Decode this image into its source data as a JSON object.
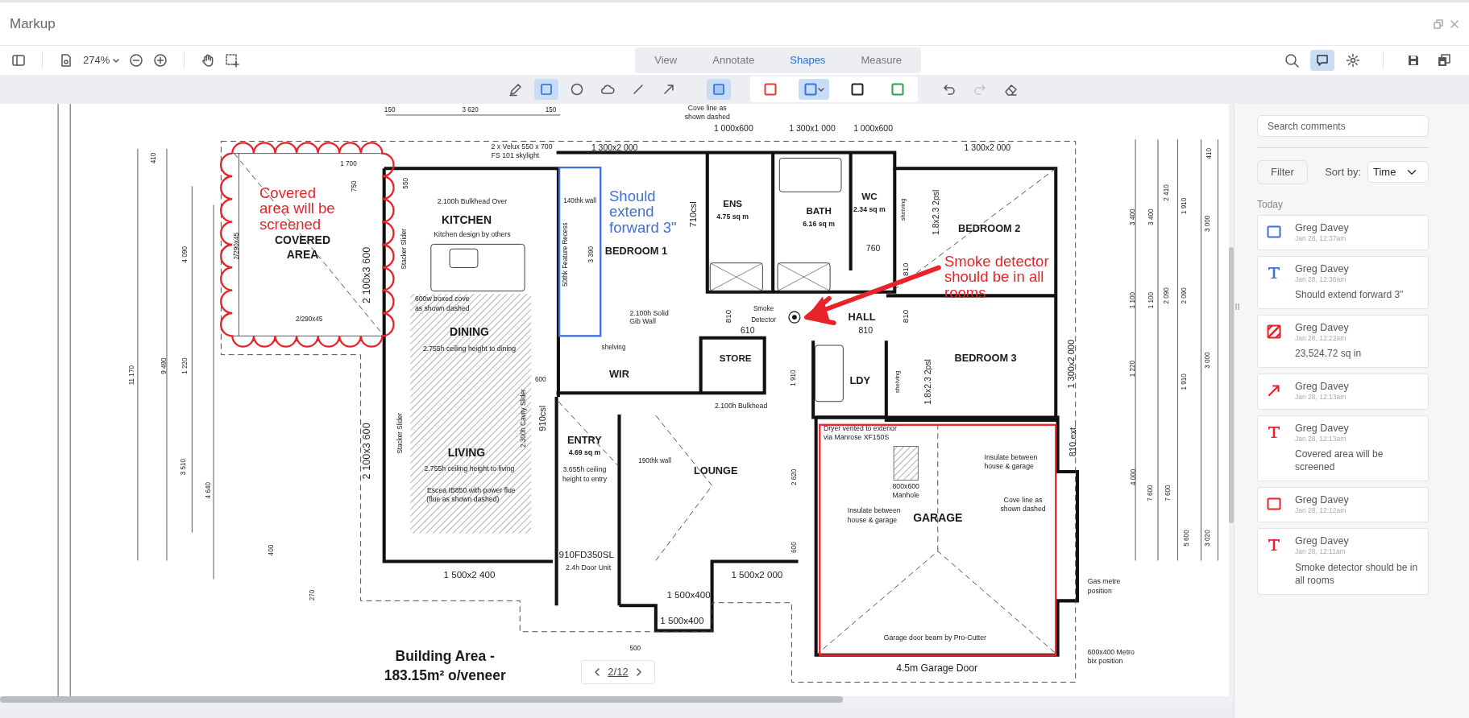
{
  "window": {
    "title": "Markup"
  },
  "toolbar": {
    "zoom": "274%",
    "comments_open": true,
    "tabs": [
      {
        "label": "View",
        "selected": false
      },
      {
        "label": "Annotate",
        "selected": false
      },
      {
        "label": "Shapes",
        "selected": true
      },
      {
        "label": "Measure",
        "selected": false
      }
    ]
  },
  "shape_tools": [
    {
      "kind": "pen",
      "selected": false
    },
    {
      "kind": "rectangle",
      "selected": true
    },
    {
      "kind": "ellipse",
      "selected": false
    },
    {
      "kind": "cloud",
      "selected": false
    },
    {
      "kind": "line",
      "selected": false
    },
    {
      "kind": "arrow",
      "selected": false
    },
    {
      "kind": "fill",
      "selected": true
    }
  ],
  "swatches": [
    {
      "color": "#e53935",
      "selected": false
    },
    {
      "color": "#3b73d9",
      "selected": true
    },
    {
      "color": "#222222",
      "selected": false
    },
    {
      "color": "#2e9e4f",
      "selected": false
    }
  ],
  "history": [
    {
      "kind": "undo",
      "disabled": false
    },
    {
      "kind": "redo",
      "disabled": true
    }
  ],
  "plan": {
    "labels": [
      "150",
      "3 620",
      "150",
      "Cove line as",
      "shown dashed",
      "1 000x600",
      "1 300x1 000",
      "1 000x600",
      "2 x Velux 550 x 700",
      "1 300x2 000",
      "1 300x2 000",
      "FS 101 skylight",
      "1 700",
      "750",
      "550",
      "2.100h Bulkhead Over",
      "KITCHEN",
      "Kitchen design by others",
      "COVERED",
      "AREA",
      "2/290x45",
      "2 100x3 600",
      "Stacker Slider",
      "600w boxed cove",
      "as shown dashed",
      "2/290x45",
      "DINING",
      "2.755h ceiling height to dining",
      "410",
      "4 090",
      "9 490",
      "1 220",
      "11 170",
      "600",
      "140thk wall",
      "50thk Feature Recess",
      "3 390",
      "BEDROOM 1",
      "710csl",
      "ENS",
      "4.75 sq m",
      "BATH",
      "6.16 sq m",
      "WC",
      "2.34 sq m",
      "shelving",
      "1.8x2.3 2psl",
      "BEDROOM 2",
      "760",
      "810",
      "2.100h Solid",
      "Gib Wall",
      "810",
      "Smoke",
      "Detector",
      "HALL",
      "810",
      "shelving",
      "610",
      "810",
      "STORE",
      "BEDROOM 3",
      "shelving",
      "1.8x2.3 2psl",
      "1 300x2 000",
      "WIR",
      "LDY",
      "1 910",
      "2.100h Bulkhead",
      "3 400",
      "3 400",
      "2 410",
      "1 910",
      "3 000",
      "410",
      "1 100",
      "1 100",
      "2 090",
      "2 090",
      "1 220",
      "1 910",
      "3 000",
      "3 510",
      "4 640",
      "400",
      "270",
      "2 100x3 600",
      "Stacker Slider",
      "LIVING",
      "2.755h ceiling height to living",
      "Escea IB850 with power flue",
      "(flue as shown dashed)",
      "2.300h Cavity Slider",
      "910csl",
      "ENTRY",
      "4.69 sq m",
      "3.655h ceiling",
      "height to entry",
      "190thk wall",
      "910FD350SL",
      "2.4h Door Unit",
      "1 500x2 400",
      "1 500x400",
      "1 500x400",
      "500",
      "Dryer vented to exterior",
      "via Manrose XF150S",
      "800x600",
      "Manhole",
      "Insulate between",
      "house & garage",
      "LOUNGE",
      "2 620",
      "Insulate between",
      "house & garage",
      "GARAGE",
      "Cove line as",
      "shown dashed",
      "600",
      "1 500x2 000",
      "Gas metre",
      "position",
      "Garage door beam by Pro-Cutter",
      "600x400 Metro",
      "bix position",
      "4.5m Garage Door",
      "810 ext.",
      "4 000",
      "7 600",
      "7 600",
      "5 600",
      "3 020",
      "Building Area -",
      "183.15m² o/veneer"
    ],
    "markups": [
      {
        "kind": "cloud",
        "color": "#e8232a"
      },
      {
        "kind": "text",
        "color": "#e8232a",
        "text": "Covered area will be screened"
      },
      {
        "kind": "rectangle",
        "color": "#3f6fd8"
      },
      {
        "kind": "text",
        "color": "#3f6fd8",
        "text": "Should extend forward 3\""
      },
      {
        "kind": "arrow",
        "color": "#e8232a"
      },
      {
        "kind": "text",
        "color": "#e8232a",
        "text": "Smoke detector should be in all rooms"
      },
      {
        "kind": "area",
        "color": "#e8232a"
      }
    ]
  },
  "pager": {
    "page": "2/12"
  },
  "comments": {
    "search_placeholder": "Search comments",
    "filter": "Filter",
    "sort_label": "Sort by:",
    "sort_value": "Time",
    "group": "Today",
    "items": [
      {
        "kind": "rectangle",
        "color": "#3f6fd8",
        "author": "Greg Davey",
        "time": "Jan 28, 12:37am"
      },
      {
        "kind": "text",
        "color": "#3f6fd8",
        "author": "Greg Davey",
        "time": "Jan 28, 12:36am",
        "text": "Should extend forward 3\""
      },
      {
        "kind": "area",
        "color": "#e8232a",
        "author": "Greg Davey",
        "time": "Jan 28, 12:22am",
        "text": "23,524.72 sq in"
      },
      {
        "kind": "arrow",
        "color": "#e8232a",
        "author": "Greg Davey",
        "time": "Jan 28, 12:13am"
      },
      {
        "kind": "text",
        "color": "#e8232a",
        "author": "Greg Davey",
        "time": "Jan 28, 12:13am",
        "text": "Covered area will be screened"
      },
      {
        "kind": "rectangle",
        "color": "#e8232a",
        "author": "Greg Davey",
        "time": "Jan 28, 12:12am"
      },
      {
        "kind": "text",
        "color": "#e8232a",
        "author": "Greg Davey",
        "time": "Jan 28, 12:11am",
        "text": "Smoke detector should be in all rooms"
      }
    ]
  }
}
